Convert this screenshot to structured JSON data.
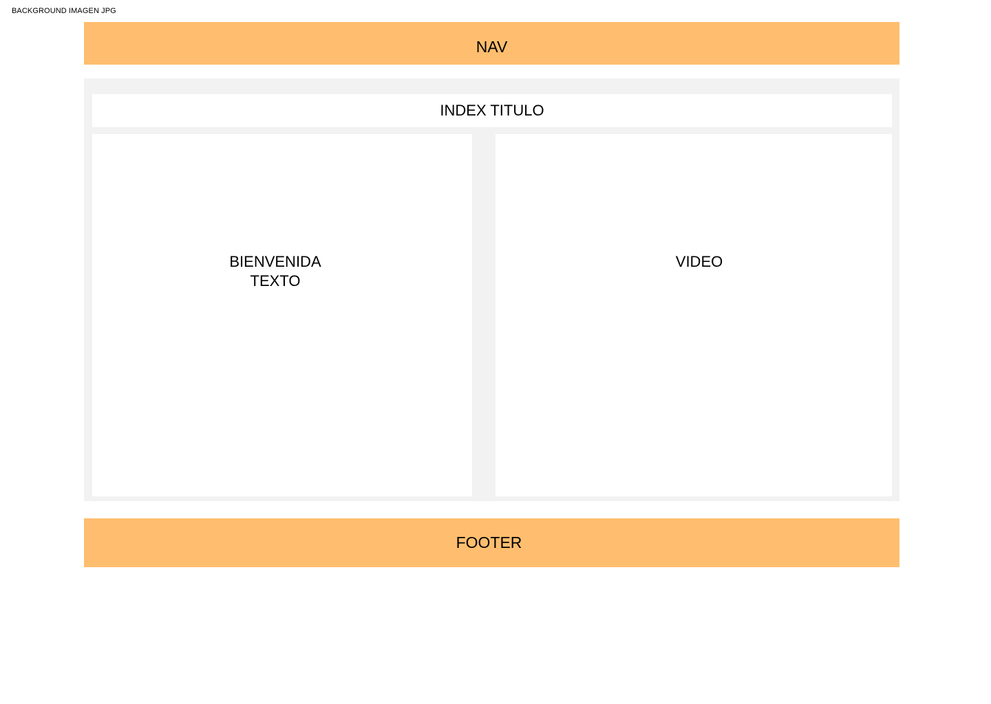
{
  "background_label": "BACKGROUND IMAGEN JPG",
  "nav": {
    "label": "NAV"
  },
  "main": {
    "title": "INDEX TITULO",
    "welcome": {
      "line1": "BIENVENIDA",
      "line2": "TEXTO"
    },
    "video": {
      "label": "VIDEO"
    }
  },
  "footer": {
    "label": "FOOTER"
  },
  "colors": {
    "nav_footer_bg": "#ffbe6f",
    "main_bg": "#f2f2f2",
    "panel_bg": "#ffffff"
  }
}
